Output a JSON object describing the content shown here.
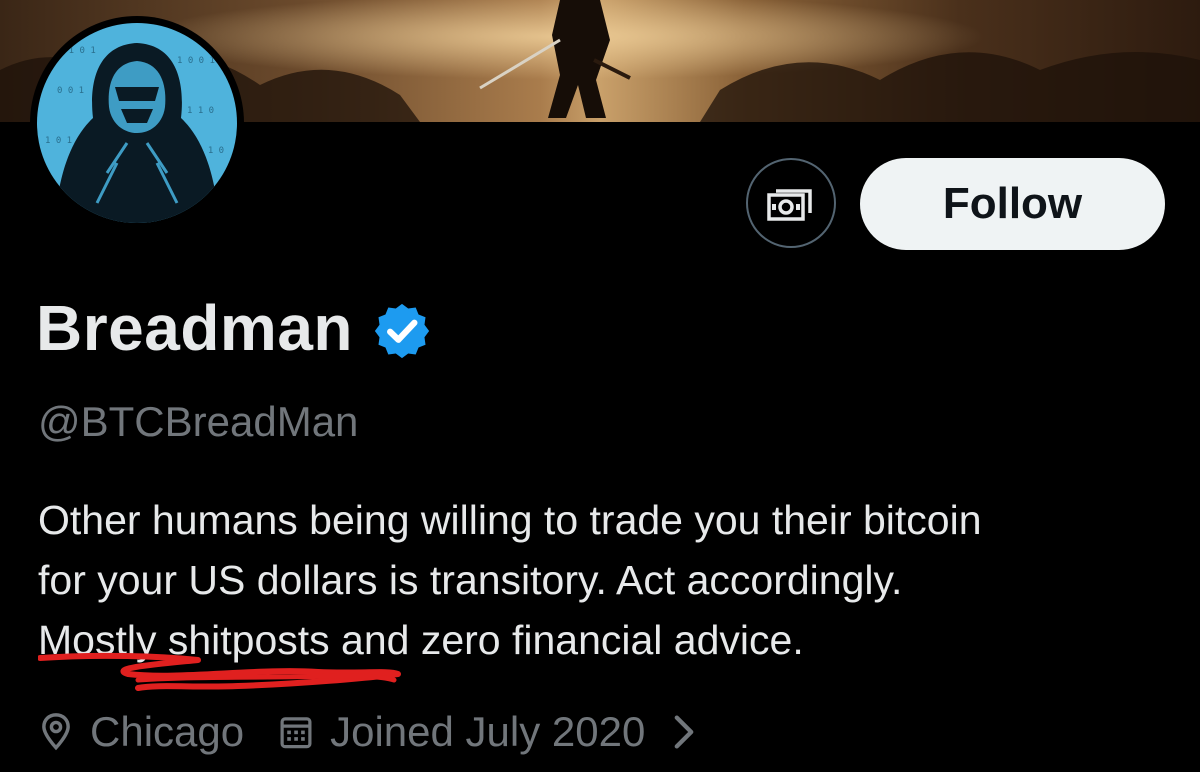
{
  "profile": {
    "display_name": "Breadman",
    "handle": "@BTCBreadMan",
    "verified": true,
    "bio_lines": [
      "Other humans being willing to trade you their bitcoin",
      "for your US dollars is transitory. Act accordingly.",
      "Mostly shitposts and zero financial advice."
    ],
    "location": "Chicago",
    "joined": "Joined July 2020"
  },
  "actions": {
    "follow_label": "Follow",
    "monetize_icon": "money-icon"
  },
  "colors": {
    "background": "#000000",
    "text_primary": "#e7e9ea",
    "text_secondary": "#71767b",
    "verified_blue": "#1d9bf0",
    "button_bg": "#eff3f4",
    "avatar_blue": "#4fb3dc",
    "scribble_red": "#e0201f"
  }
}
